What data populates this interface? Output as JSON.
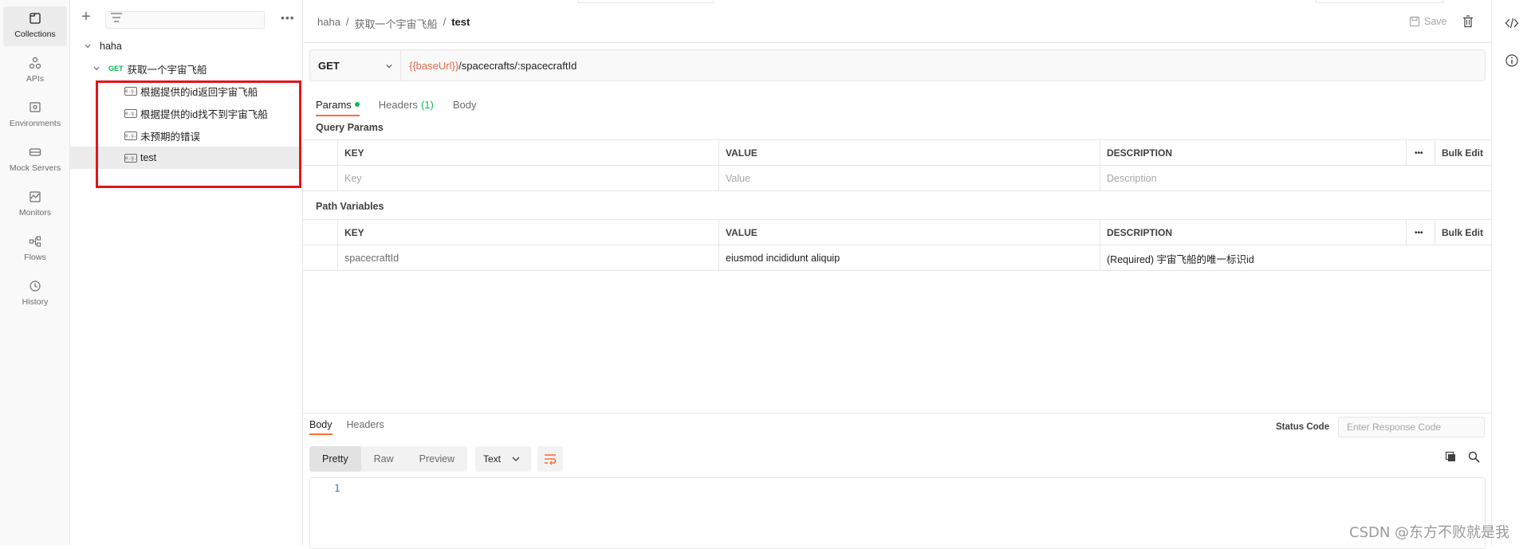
{
  "rail": [
    {
      "label": "Collections",
      "icon": "collections-icon",
      "active": true
    },
    {
      "label": "APIs",
      "icon": "apis-icon"
    },
    {
      "label": "Environments",
      "icon": "environments-icon"
    },
    {
      "label": "Mock Servers",
      "icon": "mock-servers-icon"
    },
    {
      "label": "Monitors",
      "icon": "monitors-icon"
    },
    {
      "label": "Flows",
      "icon": "flows-icon"
    },
    {
      "label": "History",
      "icon": "history-icon"
    }
  ],
  "sidebar": {
    "collection": "haha",
    "request": {
      "method": "GET",
      "name": "获取一个宇宙飞船"
    },
    "examples": [
      {
        "name": "根据提供的id返回宇宙飞船"
      },
      {
        "name": "根据提供的id找不到宇宙飞船"
      },
      {
        "name": "未预期的错误"
      },
      {
        "name": "test",
        "selected": true
      }
    ]
  },
  "header": {
    "crumbs": [
      "haha",
      "/",
      "获取一个宇宙飞船",
      "/"
    ],
    "current": "test",
    "save_label": "Save"
  },
  "request": {
    "method": "GET",
    "url_var": "{{baseUrl}}",
    "url_rest": "/spacecrafts/:spacecraftId"
  },
  "tabs": {
    "params": "Params",
    "headers": "Headers",
    "headers_count": "(1)",
    "body": "Body"
  },
  "query_params": {
    "title": "Query Params",
    "headers": {
      "key": "KEY",
      "value": "VALUE",
      "description": "DESCRIPTION",
      "more": "•••",
      "bulk": "Bulk Edit"
    },
    "placeholder": {
      "key": "Key",
      "value": "Value",
      "description": "Description"
    }
  },
  "path_variables": {
    "title": "Path Variables",
    "headers": {
      "key": "KEY",
      "value": "VALUE",
      "description": "DESCRIPTION",
      "more": "•••",
      "bulk": "Bulk Edit"
    },
    "rows": [
      {
        "key": "spacecraftId",
        "value": "eiusmod incididunt aliquip",
        "description": "(Required) 宇宙飞船的唯一标识id"
      }
    ]
  },
  "response": {
    "tabs": [
      "Body",
      "Headers"
    ],
    "status_label": "Status Code",
    "status_placeholder": "Enter Response Code",
    "views": [
      "Pretty",
      "Raw",
      "Preview"
    ],
    "format": "Text",
    "line_number": "1"
  },
  "colors": {
    "accent": "#ff6c37",
    "get": "#0cbb52",
    "highlight": "#e0151b",
    "var": "#e06a4a"
  },
  "watermark": "CSDN @东方不败就是我"
}
